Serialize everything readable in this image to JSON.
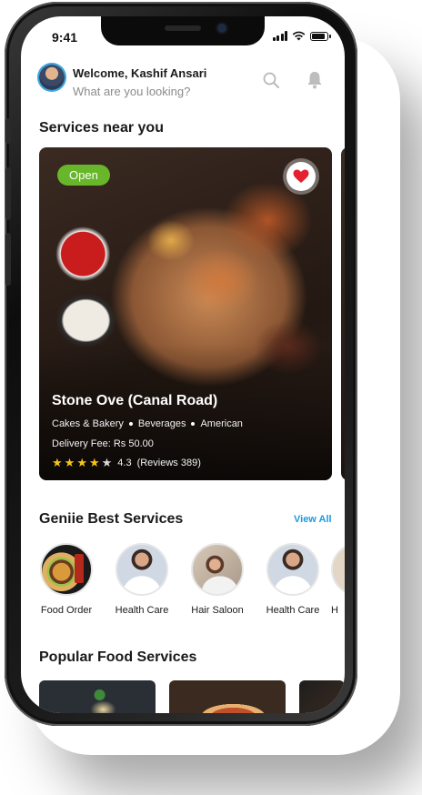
{
  "status_bar": {
    "time": "9:41"
  },
  "header": {
    "welcome": "Welcome, Kashif Ansari",
    "subtitle": "What are you looking?"
  },
  "services_near_title": "Services near you",
  "featured": {
    "status_badge": "Open",
    "name": "Stone Ove (Canal Road)",
    "categories": [
      "Cakes & Bakery",
      "Beverages",
      "American"
    ],
    "delivery_label": "Delivery Fee:",
    "delivery_fee": "Rs 50.00",
    "rating_value": 4.3,
    "rating_text": "4.3",
    "reviews_text": "(Reviews 389)",
    "favorite": true
  },
  "best_services": {
    "title": "Geniie Best Services",
    "view_all": "View All",
    "items": [
      {
        "label": "Food Order"
      },
      {
        "label": "Health Care"
      },
      {
        "label": "Hair Saloon"
      },
      {
        "label": "Health Care"
      },
      {
        "label": "H"
      }
    ]
  },
  "popular_title": "Popular Food Services",
  "colors": {
    "accent": "#1a9be0",
    "open_badge": "#68b62a",
    "heart": "#e5202e",
    "star": "#f5c518"
  }
}
